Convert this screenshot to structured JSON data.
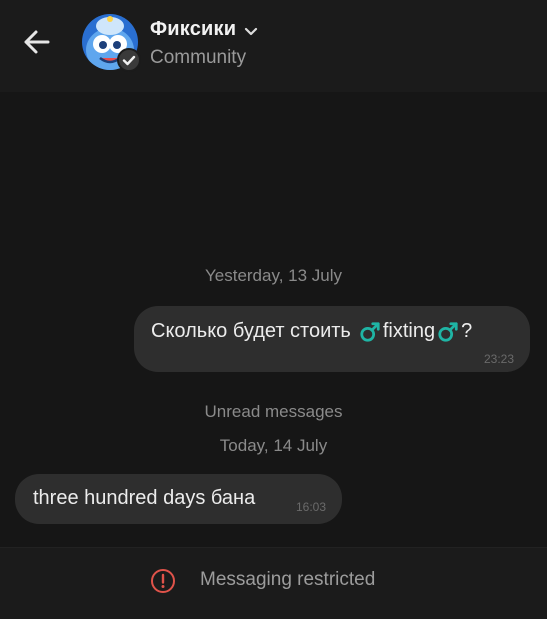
{
  "header": {
    "title": "Фиксики",
    "subtitle": "Community",
    "back_icon": "arrow-left-icon",
    "avatar_icon": "fixik-avatar",
    "verified_icon": "checkmark-icon",
    "chevron_icon": "chevron-down-icon"
  },
  "messages": {
    "date_yesterday": "Yesterday, 13 July",
    "outgoing": {
      "text_before": "Сколько будет стоить",
      "emoji": "male-sign-emoji",
      "text_middle": "fixting",
      "text_after": "?",
      "time": "23:23"
    },
    "unread_label": "Unread messages",
    "date_today": "Today, 14 July",
    "incoming": {
      "text": "three hundred days бана",
      "time": "16:03"
    }
  },
  "footer": {
    "status_icon": "exclamation-circle-icon",
    "status_text": "Messaging restricted"
  },
  "colors": {
    "background": "#161616",
    "bubble": "#2e2e2e",
    "emoji_accent": "#1fb5a5",
    "warning_icon": "#e0534a"
  }
}
